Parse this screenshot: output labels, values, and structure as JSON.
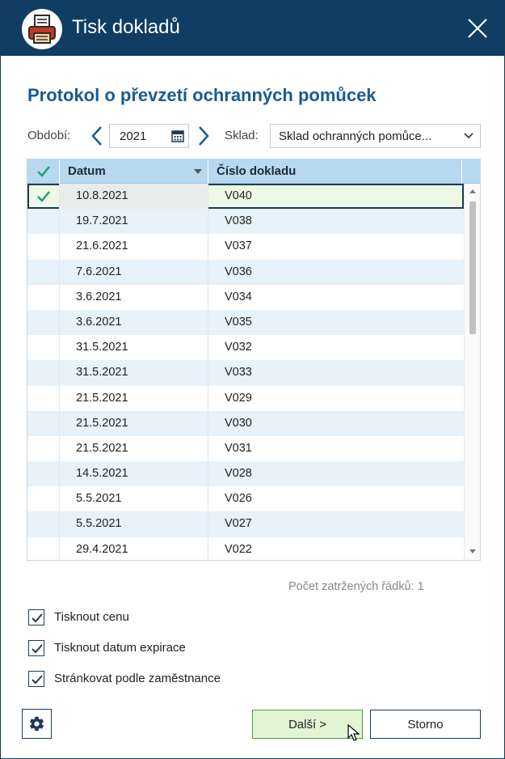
{
  "window": {
    "title": "Tisk dokladů",
    "icon": "printer-icon"
  },
  "heading": "Protokol o převzetí ochranných pomůcek",
  "filters": {
    "period_label": "Období:",
    "year": "2021",
    "warehouse_label": "Sklad:",
    "warehouse_value": "Sklad ochranných pomůce..."
  },
  "grid": {
    "columns": [
      "Datum",
      "Číslo dokladu"
    ],
    "rows": [
      {
        "datum": "10.8.2021",
        "cislo": "V040",
        "checked": true
      },
      {
        "datum": "19.7.2021",
        "cislo": "V038",
        "checked": false
      },
      {
        "datum": "21.6.2021",
        "cislo": "V037",
        "checked": false
      },
      {
        "datum": "7.6.2021",
        "cislo": "V036",
        "checked": false
      },
      {
        "datum": "3.6.2021",
        "cislo": "V034",
        "checked": false
      },
      {
        "datum": "3.6.2021",
        "cislo": "V035",
        "checked": false
      },
      {
        "datum": "31.5.2021",
        "cislo": "V032",
        "checked": false
      },
      {
        "datum": "31.5.2021",
        "cislo": "V033",
        "checked": false
      },
      {
        "datum": "21.5.2021",
        "cislo": "V029",
        "checked": false
      },
      {
        "datum": "21.5.2021",
        "cislo": "V030",
        "checked": false
      },
      {
        "datum": "21.5.2021",
        "cislo": "V031",
        "checked": false
      },
      {
        "datum": "14.5.2021",
        "cislo": "V028",
        "checked": false
      },
      {
        "datum": "5.5.2021",
        "cislo": "V026",
        "checked": false
      },
      {
        "datum": "5.5.2021",
        "cislo": "V027",
        "checked": false
      },
      {
        "datum": "29.4.2021",
        "cislo": "V022",
        "checked": false
      }
    ]
  },
  "count_text": "Počet zatržených řádků: 1",
  "options": [
    {
      "label": "Tisknout cenu",
      "checked": true
    },
    {
      "label": "Tisknout datum expirace",
      "checked": true
    },
    {
      "label": "Stránkovat podle zaměstnance",
      "checked": true
    }
  ],
  "buttons": {
    "next": "Další >",
    "cancel": "Storno"
  },
  "colors": {
    "titlebar": "#0f3d63",
    "heading": "#185c8f",
    "check_green": "#1f9a7a",
    "header_bg": "#b6d8f0",
    "row_alt": "#e7f2fb",
    "next_button_bg": "#e1f4d4"
  }
}
